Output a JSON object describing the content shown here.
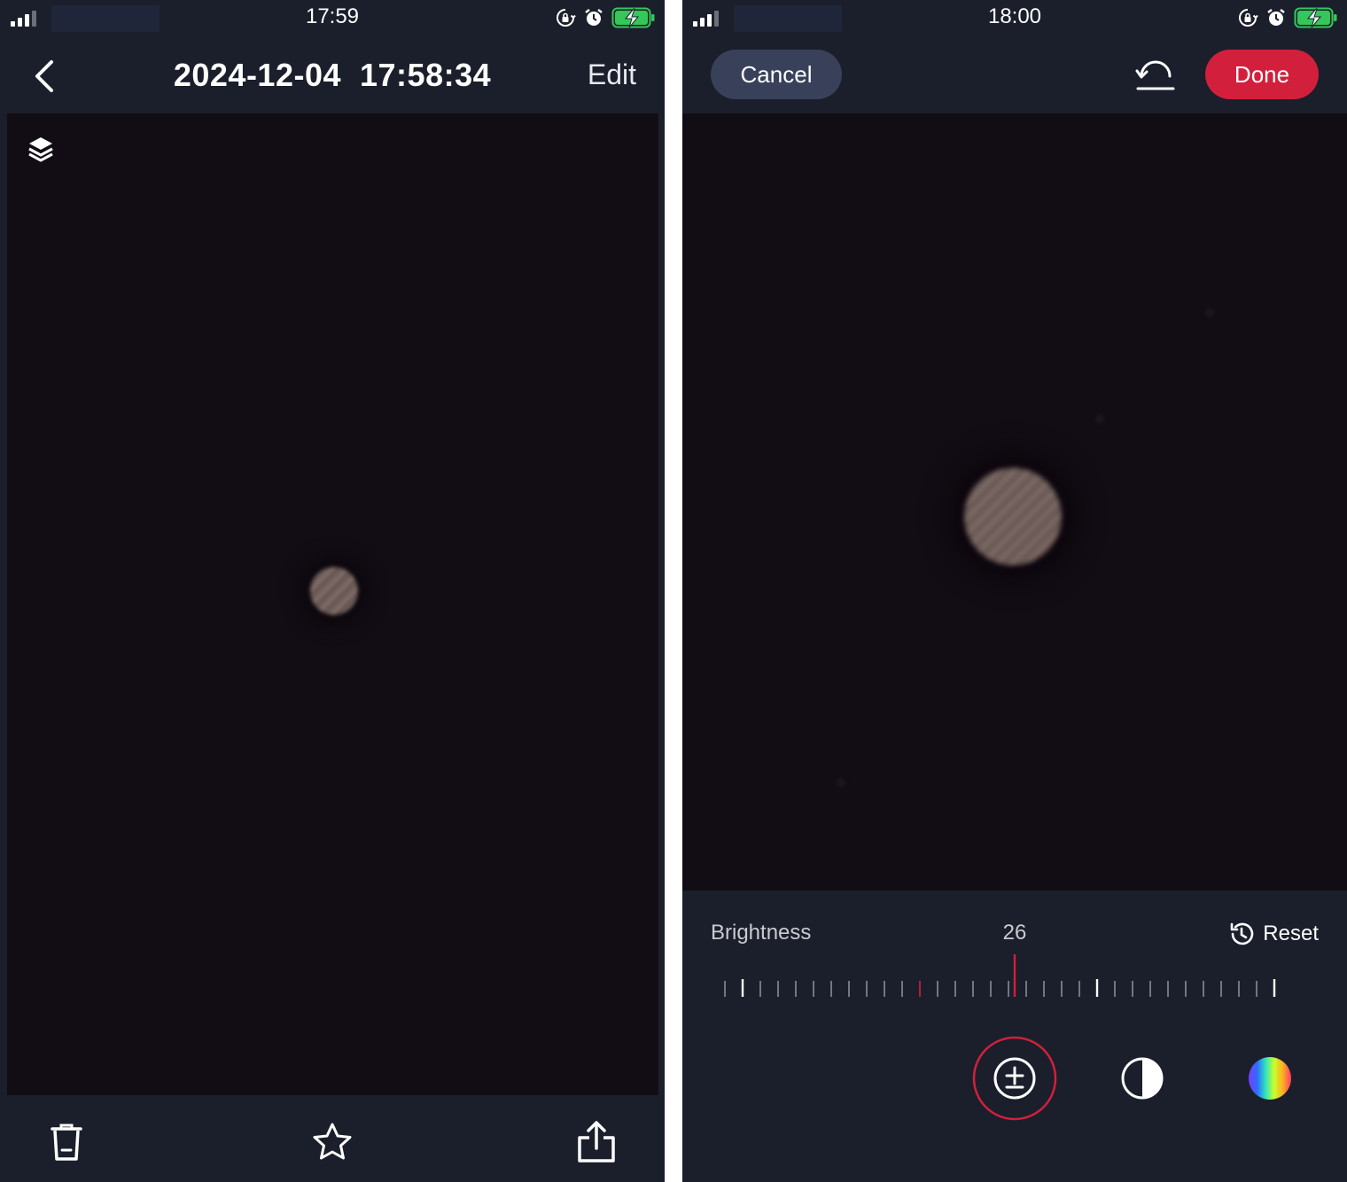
{
  "left": {
    "status": {
      "time": "17:59"
    },
    "nav": {
      "title": "2024-12-04  17:58:34",
      "edit_label": "Edit"
    }
  },
  "right": {
    "status": {
      "time": "18:00"
    },
    "header": {
      "cancel_label": "Cancel",
      "done_label": "Done"
    },
    "adjust": {
      "label": "Brightness",
      "value": "26",
      "reset_label": "Reset"
    },
    "slider": {
      "value": 26
    }
  },
  "colors": {
    "background": "#1b1f2b",
    "photo": "#120d14",
    "accent": "#d2203c",
    "cancel": "#39415a",
    "battery": "#34c759"
  },
  "icons": [
    "signal-icon",
    "rotation-lock-icon",
    "alarm-icon",
    "battery-charging-icon",
    "back-chevron-icon",
    "layers-icon",
    "trash-icon",
    "star-icon",
    "share-icon",
    "undo-icon",
    "history-icon",
    "exposure-icon",
    "contrast-icon",
    "color-wheel-icon"
  ]
}
